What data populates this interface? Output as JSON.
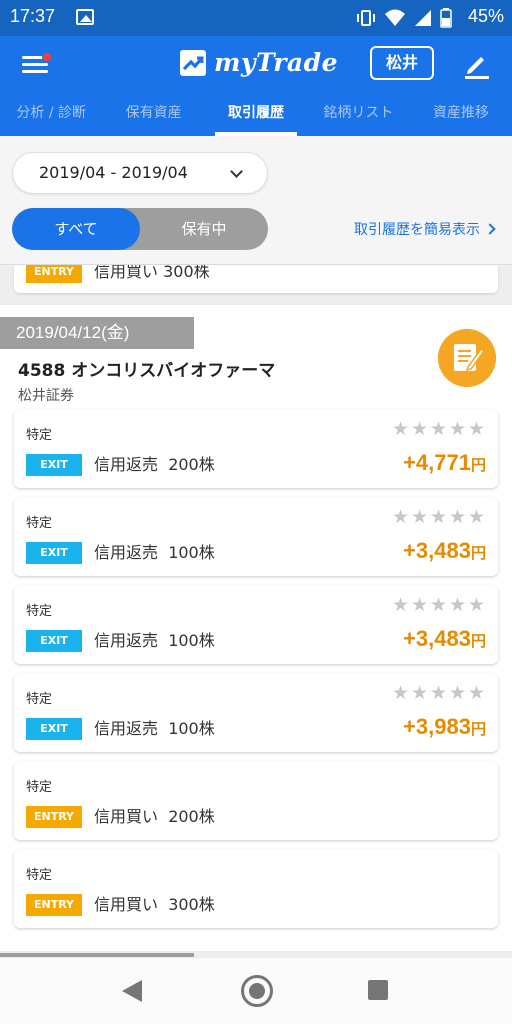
{
  "status": {
    "time": "17:37",
    "battery": "45%"
  },
  "header": {
    "app_name": "myTrade",
    "user_label": "松井"
  },
  "tabs": [
    {
      "label": "分析 / 診断",
      "active": false
    },
    {
      "label": "保有資産",
      "active": false
    },
    {
      "label": "取引履歴",
      "active": true
    },
    {
      "label": "銘柄リスト",
      "active": false
    },
    {
      "label": "資産推移",
      "active": false
    }
  ],
  "filter": {
    "date_range": "2019/04 - 2019/04",
    "segments": [
      "すべて",
      "保有中"
    ],
    "simple_view_link": "取引履歴を簡易表示"
  },
  "previous_card": {
    "badge": "ENTRY",
    "text": "信用買い 300株"
  },
  "group": {
    "date": "2019/04/12(金)",
    "stock": "4588 オンコリスバイオファーマ",
    "broker": "松井証券",
    "trades": [
      {
        "type": "特定",
        "badge": "EXIT",
        "action": "信用返売",
        "qty": "200株",
        "profit": "+4,771",
        "unit": "円",
        "rating": 0
      },
      {
        "type": "特定",
        "badge": "EXIT",
        "action": "信用返売",
        "qty": "100株",
        "profit": "+3,483",
        "unit": "円",
        "rating": 0
      },
      {
        "type": "特定",
        "badge": "EXIT",
        "action": "信用返売",
        "qty": "100株",
        "profit": "+3,483",
        "unit": "円",
        "rating": 0
      },
      {
        "type": "特定",
        "badge": "EXIT",
        "action": "信用返売",
        "qty": "100株",
        "profit": "+3,983",
        "unit": "円",
        "rating": 0
      },
      {
        "type": "特定",
        "badge": "ENTRY",
        "action": "信用買い",
        "qty": "200株",
        "profit": "",
        "unit": "",
        "rating": null
      },
      {
        "type": "特定",
        "badge": "ENTRY",
        "action": "信用買い",
        "qty": "300株",
        "profit": "",
        "unit": "",
        "rating": null
      }
    ]
  },
  "colors": {
    "primary": "#1a73e8",
    "exit_badge": "#1ab3ec",
    "entry_badge": "#f5a800",
    "profit": "#e88a00",
    "note_button": "#f5a623"
  },
  "icons": [
    "image-icon",
    "vibrate-icon",
    "wifi-icon",
    "signal-icon",
    "battery-icon",
    "menu-icon",
    "mytrade-logo-icon",
    "edit-icon",
    "chevron-down-icon",
    "chevron-right-icon",
    "note-edit-icon",
    "star-icon",
    "back-icon",
    "home-icon",
    "recent-apps-icon"
  ]
}
